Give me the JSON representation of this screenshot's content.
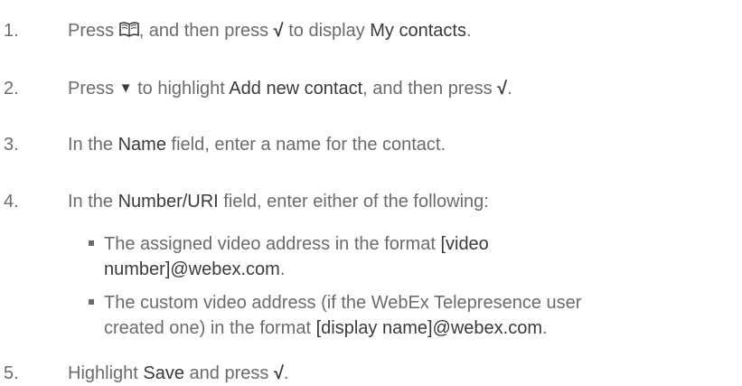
{
  "steps": [
    {
      "num": "1.",
      "t1": "Press ",
      "icon": "book-icon",
      "t2": ", and then press ",
      "sym": "√",
      "t3": " to display ",
      "b1": "My contacts",
      "t4": "."
    },
    {
      "num": "2.",
      "t1": "Press ",
      "arrow": "▼",
      "t2": " to highlight ",
      "b1": "Add new contact",
      "t3": ", and then press ",
      "sym": "√",
      "t4": "."
    },
    {
      "num": "3.",
      "t1": "In the ",
      "b1": "Name",
      "t2": " field, enter a name for the contact."
    },
    {
      "num": "4.",
      "t1": "In the ",
      "b1": "Number/URI",
      "t2": " field, enter either of the following:"
    },
    {
      "num": "5.",
      "t1": "Highlight ",
      "b1": "Save",
      "t2": " and press ",
      "sym": "√",
      "t3": "."
    }
  ],
  "bullets": [
    {
      "line1_t": "The assigned video address in the format ",
      "line1_b": "[video",
      "line2_b": "number]@webex.com",
      "line2_t": "."
    },
    {
      "line1_t": "The custom video address (if the WebEx Telepresence user",
      "line2_t1": "created one) in the format ",
      "line2_b": "[display name]@webex.com",
      "line2_t2": "."
    }
  ]
}
